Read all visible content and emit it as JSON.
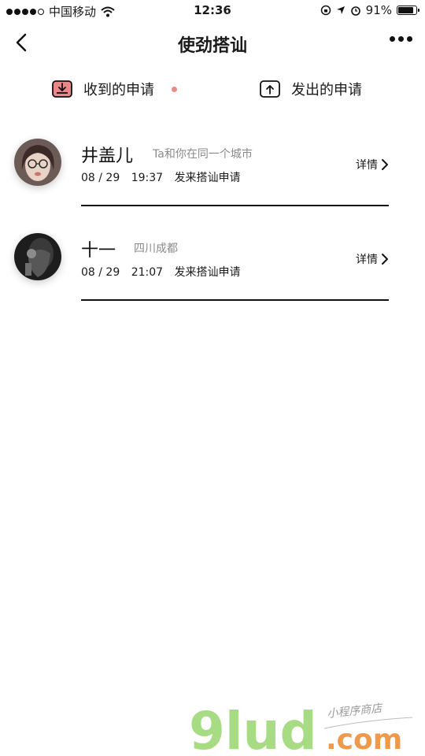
{
  "status_bar": {
    "carrier": "中国移动",
    "time": "12:36",
    "battery_percent": "91%",
    "battery_level": 0.91
  },
  "nav": {
    "title": "使劲搭讪"
  },
  "tabs": {
    "received": {
      "label": "收到的申请",
      "has_unread": true
    },
    "sent": {
      "label": "发出的申请"
    }
  },
  "requests": [
    {
      "name": "井盖儿",
      "location": "Ta和你在同一个城市",
      "date": "08 / 29",
      "time": "19:37",
      "action": "发来搭讪申请",
      "detail_label": "详情"
    },
    {
      "name": "十一",
      "location": "四川成都",
      "date": "08 / 29",
      "time": "21:07",
      "action": "发来搭讪申请",
      "detail_label": "详情"
    }
  ],
  "watermark": {
    "brand": "9lud",
    "domain": ".com",
    "tagline": "小程序商店"
  },
  "colors": {
    "accent": "#e9878b",
    "text": "#1a1a1a",
    "muted": "#8a8a8a",
    "watermark_green": "#a8dc84"
  }
}
